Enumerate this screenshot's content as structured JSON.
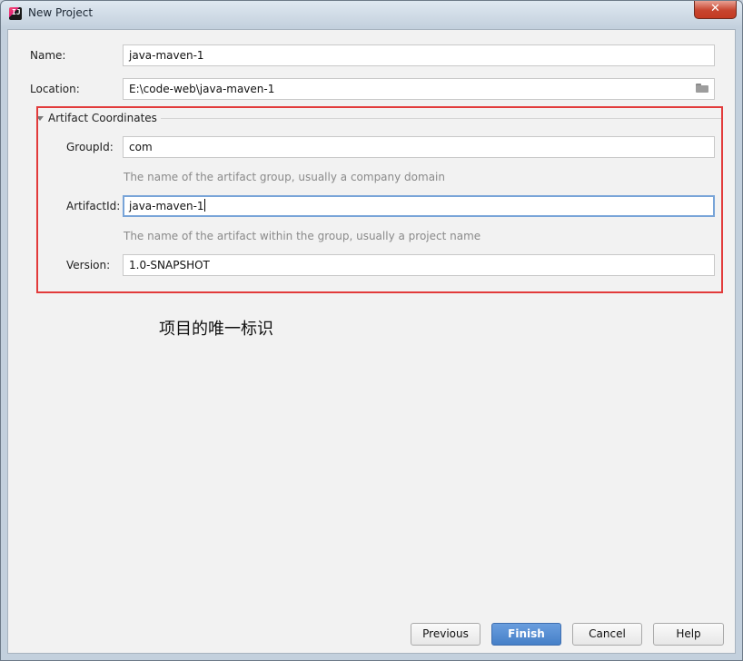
{
  "window": {
    "title": "New Project",
    "close_label": "✕"
  },
  "form": {
    "name_label": "Name:",
    "name_value": "java-maven-1",
    "location_label": "Location:",
    "location_value": "E:\\code-web\\java-maven-1"
  },
  "artifact": {
    "section_label": "Artifact Coordinates",
    "group_label": "GroupId:",
    "group_value": "com",
    "group_hint": "The name of the artifact group, usually a company domain",
    "artifact_label": "ArtifactId:",
    "artifact_value": "java-maven-1",
    "artifact_hint": "The name of the artifact within the group, usually a project name",
    "version_label": "Version:",
    "version_value": "1.0-SNAPSHOT"
  },
  "annotation": "项目的唯一标识",
  "buttons": {
    "previous": "Previous",
    "finish": "Finish",
    "cancel": "Cancel",
    "help": "Help"
  },
  "colors": {
    "annotation_box": "#e23b3b",
    "primary_button": "#4a84cc"
  }
}
